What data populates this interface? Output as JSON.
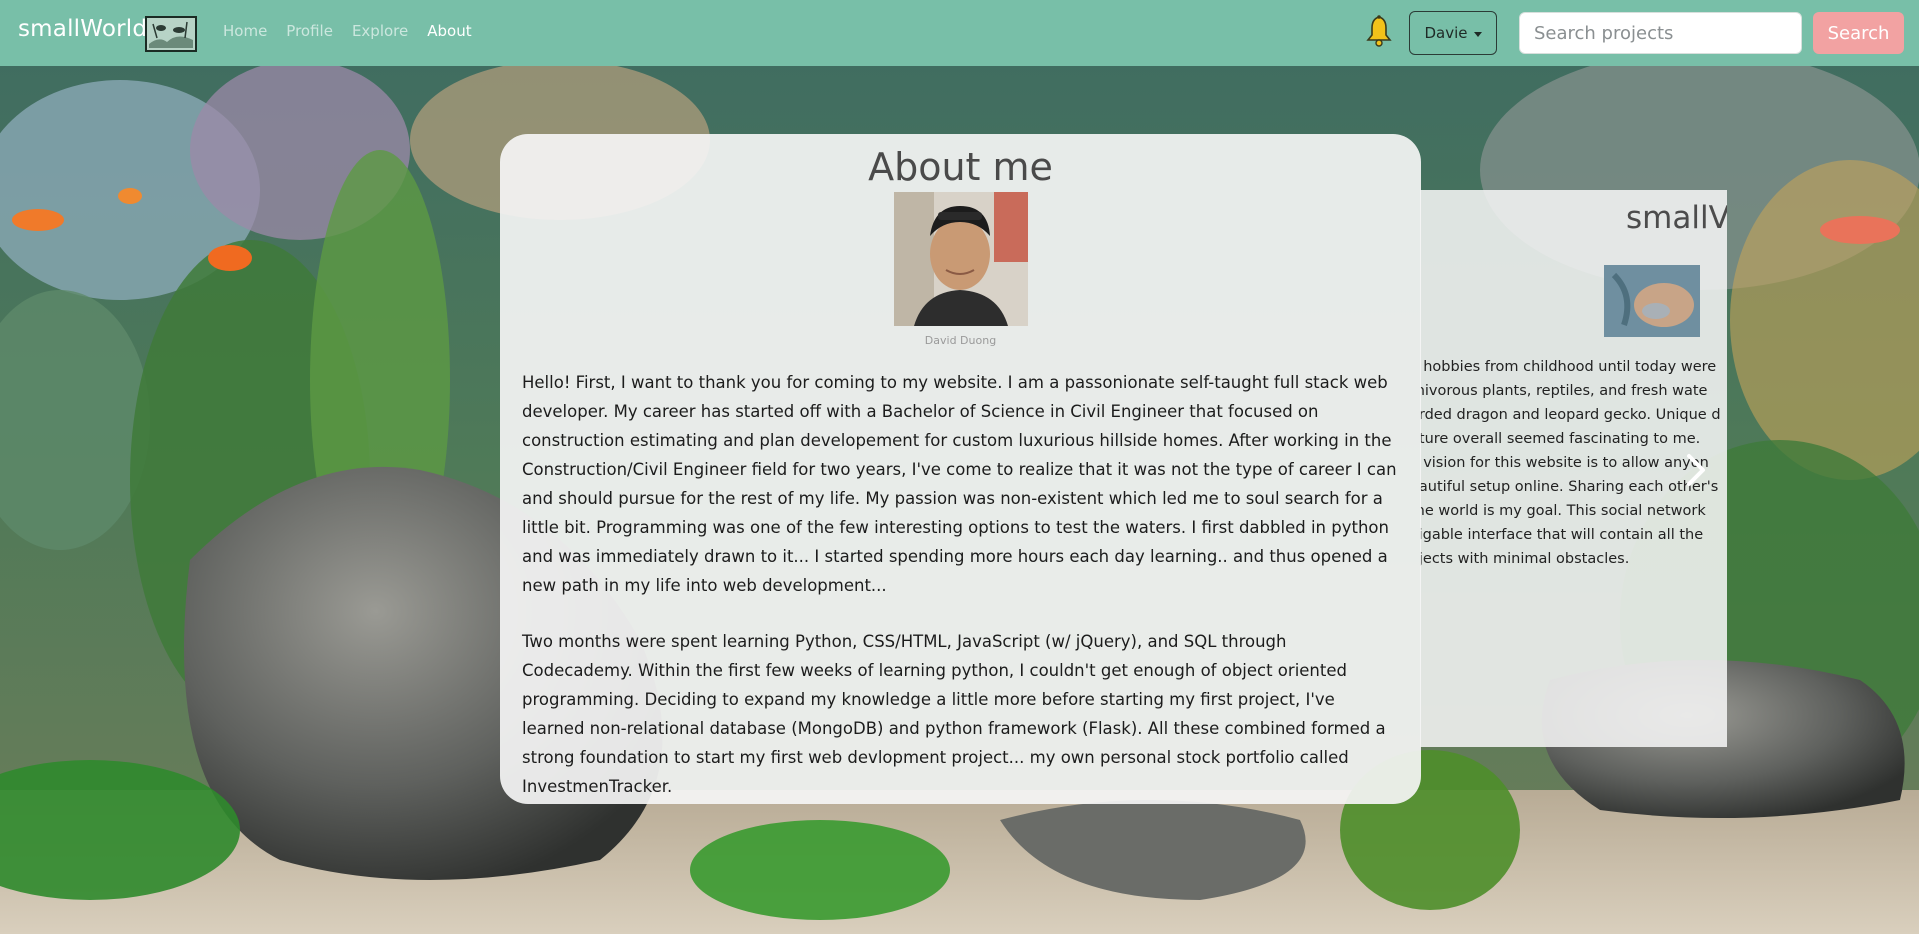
{
  "navbar": {
    "brand": "smallWorld",
    "links": [
      {
        "label": "Home",
        "active": false
      },
      {
        "label": "Profile",
        "active": false
      },
      {
        "label": "Explore",
        "active": false
      },
      {
        "label": "About",
        "active": true
      }
    ],
    "user_menu_label": "Davie",
    "search_placeholder": "Search projects",
    "search_button_label": "Search",
    "icons": [
      "brand-logo-icon",
      "bell-icon",
      "caret-down-icon"
    ]
  },
  "about": {
    "title": "About me",
    "photo_caption": "David Duong",
    "paragraphs": [
      "Hello! First, I want to thank you for coming to my website. I am a passonionate self-taught full stack web developer. My career has started off with a Bachelor of Science in Civil Engineer that focused on construction estimating and plan developement for custom luxurious hillside homes. After working in the Construction/Civil Engineer field for two years, I've come to realize that it was not the type of career I can and should pursue for the rest of my life. My passion was non-existent which led me to soul search for a little bit. Programming was one of the few interesting options to test the waters. I first dabbled in python and was immediately drawn to it... I started spending more hours each day learning.. and thus opened a new path in my life into web development...",
      "Two months were spent learning Python, CSS/HTML, JavaScript (w/ jQuery), and SQL through Codecademy. Within the first few weeks of learning python, I couldn't get enough of object oriented programming. Deciding to expand my knowledge a little more before starting my first project, I've learned non-relational database (MongoDB) and python framework (Flask). All these combined formed a strong foundation to start my first web devlopment project... my own personal stock portfolio called InvestmenTracker."
    ]
  },
  "next_slide": {
    "title": "smallV",
    "text": "y hobbies from childhood until today were\nrnivorous plants, reptiles, and fresh wate\narded dragon and leopard gecko. Unique d\nature overall seemed fascinating to me.\ny vision for this website is to allow anyon\neautiful setup online. Sharing each other's\n the world is my goal. This social network\nvigable interface that will contain all the\nojects with minimal obstacles.",
    "icons": [
      "chevron-right-icon"
    ]
  },
  "colors": {
    "navbar": "#78bfa8",
    "search_button": "#f2a2a2",
    "card": "#f5f5f5"
  }
}
